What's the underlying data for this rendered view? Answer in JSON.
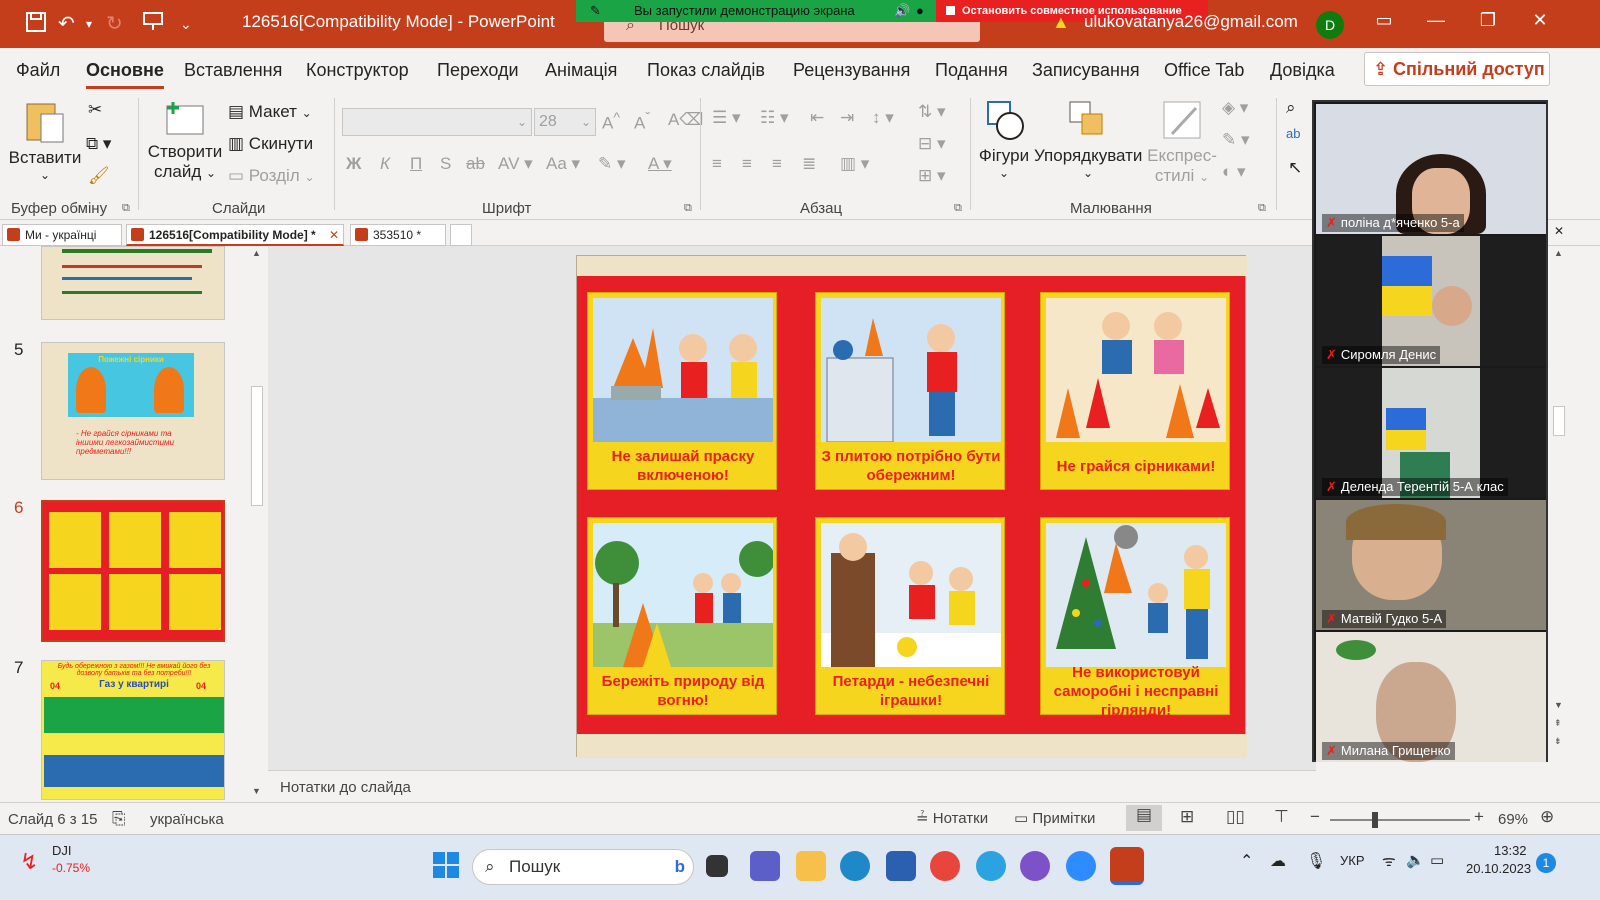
{
  "titlebar": {
    "doc_title": "126516[Compatibility Mode]  -  PowerPoint",
    "search_placeholder": "Пошук",
    "share_banner": "Вы запустили демонстрацию экрана",
    "stop_share": "Остановить совместное использование",
    "user_email": "ulukovatanya26@gmail.com",
    "avatar_initial": "D"
  },
  "menu": {
    "items": [
      "Файл",
      "Основне",
      "Вставлення",
      "Конструктор",
      "Переходи",
      "Анімація",
      "Показ слайдів",
      "Рецензування",
      "Подання",
      "Записування",
      "Office Tab",
      "Довідка"
    ],
    "share": "Спільний доступ"
  },
  "ribbon": {
    "clipboard": {
      "paste": "Вставити",
      "label": "Буфер обміну"
    },
    "slides": {
      "new_slide_1": "Створити",
      "new_slide_2": "слайд",
      "layout": "Макет",
      "reset": "Скинути",
      "section": "Розділ",
      "label": "Слайди"
    },
    "font": {
      "size": "28",
      "label": "Шрифт"
    },
    "paragraph": {
      "label": "Абзац"
    },
    "drawing": {
      "shapes": "Фігури",
      "arrange": "Упорядкувати",
      "quick_1": "Експрес-",
      "quick_2": "стилі",
      "label": "Малювання"
    }
  },
  "doctabs": [
    {
      "label": "Ми - українці"
    },
    {
      "label": "126516[Compatibility Mode] *"
    },
    {
      "label": "353510 *"
    }
  ],
  "thumbnails": {
    "n5": "5",
    "n6": "6",
    "n7": "7",
    "t5_title": "Пожежні сірники",
    "t5_text": "- Не грайся сірниками та іншими легкозаймистими предметами!!!",
    "t7_title": "Будь обережною з газом!!! Не вмикай його без дозволу батьків та без потреби!!!",
    "t7_head": "Газ у квартирі",
    "t7_04": "04"
  },
  "slide": {
    "captions": [
      "Не залишай праску включеною!",
      "З плитою потрібно бути обережним!",
      "Не грайся сірниками!",
      "Бережіть природу від вогню!",
      "Петарди - небезпечні іграшки!",
      "Не використовуй саморобні і несправні гірлянди!"
    ]
  },
  "notes_placeholder": "Нотатки до слайда",
  "participants": [
    "поліна д*яченко 5-а",
    "Сиромля Денис",
    "Деленда Терентій 5-А клас",
    "Матвій Гудко 5-А",
    "Милана Грищенко"
  ],
  "statusbar": {
    "slide_count": "Слайд 6 з 15",
    "language": "українська",
    "notes": "Нотатки",
    "comments": "Примітки",
    "zoom": "69%"
  },
  "taskbar": {
    "stock_name": "DJI",
    "stock_change": "-0.75%",
    "search": "Пошук",
    "lang": "УКР",
    "time": "13:32",
    "date": "20.10.2023",
    "badge": "1"
  },
  "colors": {
    "accent": "#c43e1c",
    "slide_red": "#e61e26",
    "card_yellow": "#f6d51f",
    "share_green": "#1ba446"
  }
}
